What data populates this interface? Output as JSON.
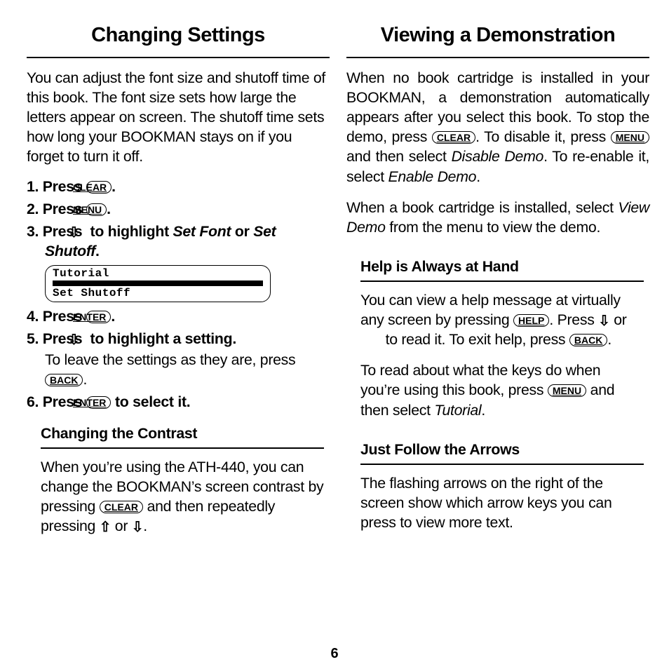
{
  "page_number": "6",
  "left": {
    "heading": "Changing Settings",
    "intro": "You can adjust the font size and shutoff time of this book. The font size sets how large the letters appear on screen. The shutoff time sets how long your BOOKMAN stays on if you forget to turn it off.",
    "steps": {
      "s1a": "Press ",
      "s1b": ".",
      "s2a": "Press ",
      "s2b": ".",
      "s3a": "Press ",
      "s3b": " to highlight ",
      "s3c": "Set Font",
      "s3d": " or ",
      "s3e": "Set Shutoff",
      "s3f": ".",
      "s4a": "Press ",
      "s4b": ".",
      "s5a": "Press ",
      "s5b": " to highlight a setting.",
      "s5sub_a": "To leave the settings as they are, press ",
      "s5sub_b": ".",
      "s6a": "Press ",
      "s6b": " to select it."
    },
    "keys": {
      "clear": "CLEAR",
      "menu": "MENU",
      "enter": "ENTER",
      "back": "BACK"
    },
    "screen": {
      "l1": "Tutorial",
      "l2": "Set Shutoff"
    },
    "callout": {
      "title": "Changing the Contrast",
      "p1a": "When you’re using the ATH-440, you can change the BOOKMAN’s screen contrast by pressing  ",
      "p1b": " and then repeatedly pressing ",
      "p1c": " or ",
      "p1d": "."
    }
  },
  "right": {
    "heading": "Viewing a Demonstration",
    "p1a": "When no book cartridge is installed in your BOOKMAN, a demonstration automatically appears after you select this book. To stop the demo, press ",
    "p1b": ". To disable it, press ",
    "p1c": " and then select ",
    "p1d": "Disable Demo",
    "p1e": ". To re-enable it, select ",
    "p1f": "Enable Demo",
    "p1g": ".",
    "p2a": "When a book cartridge is installed, select ",
    "p2b": "View Demo",
    "p2c": " from the menu to view the demo.",
    "keys": {
      "clear": "CLEAR",
      "menu": "MENU",
      "help": "HELP",
      "back": "BACK"
    },
    "help": {
      "title": "Help is Always at Hand",
      "p1a": "You can view a help message at virtually any screen by pressing ",
      "p1b": ". Press ",
      "p1c": " or ",
      "p1d": " to read it. To exit help, press ",
      "p1e": ".",
      "p2a": "To read about what the keys do when you’re using this book, press ",
      "p2b": " and then select ",
      "p2c": "Tutorial",
      "p2d": "."
    },
    "arrows": {
      "title": "Just Follow the Arrows",
      "p1": "The flashing arrows on the right of the screen show which arrow keys you can press to view more text."
    }
  },
  "glyphs": {
    "down": "⇩",
    "up": "⇧"
  }
}
